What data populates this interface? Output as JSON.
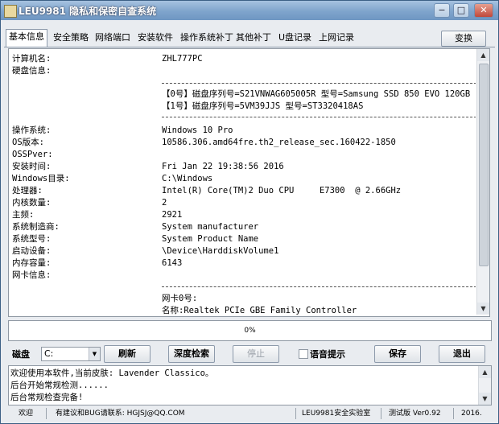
{
  "window": {
    "title": "LEU9981 隐私和保密自查系统",
    "minimize": "−",
    "maximize": "□",
    "close": "✕"
  },
  "tabs": [
    {
      "label": "基本信息",
      "active": true
    },
    {
      "label": "安全策略"
    },
    {
      "label": "网络端口"
    },
    {
      "label": "安装软件"
    },
    {
      "label": "操作系统补丁"
    },
    {
      "label": "其他补丁"
    },
    {
      "label": "U盘记录"
    },
    {
      "label": "上网记录"
    }
  ],
  "change_button": "变换",
  "info": {
    "computer_name": {
      "label": "计算机名:",
      "value": "ZHL777PC"
    },
    "disk_info_label": "硬盘信息:",
    "disks": [
      "【0号】磁盘序列号=S21VNWAG605005R 型号=Samsung SSD 850 EVO 120GB",
      "【1号】磁盘序列号=5VM39JJS 型号=ST3320418AS"
    ],
    "fields": [
      {
        "label": "操作系统:",
        "value": "Windows 10 Pro"
      },
      {
        "label": "OS版本:",
        "value": "10586.306.amd64fre.th2_release_sec.160422-1850"
      },
      {
        "label": "OSSPver:",
        "value": ""
      },
      {
        "label": "安装时间:",
        "value": "Fri Jan 22 19:38:56 2016"
      },
      {
        "label": "Windows目录:",
        "value": "C:\\Windows"
      },
      {
        "label": "处理器:",
        "value": "Intel(R) Core(TM)2 Duo CPU     E7300  @ 2.66GHz"
      },
      {
        "label": "内核数量:",
        "value": "2"
      },
      {
        "label": "主频:",
        "value": "2921"
      },
      {
        "label": "系统制造商:",
        "value": "System manufacturer"
      },
      {
        "label": "系统型号:",
        "value": "System Product Name"
      },
      {
        "label": "启动设备:",
        "value": "\\Device\\HarddiskVolume1"
      },
      {
        "label": "内存容量:",
        "value": "6143"
      }
    ],
    "nic_label": "网卡信息:",
    "nic_first": "网卡0号:",
    "nic_partial": "名称:Realtek PCIe GBE Family Controller"
  },
  "progress": {
    "value": 0,
    "text": "0%"
  },
  "controls": {
    "disk_label": "磁盘",
    "disk_value": "C:",
    "refresh": "刷新",
    "deep_scan": "深度检索",
    "stop": "停止",
    "voice_prompt": "语音提示",
    "save": "保存",
    "exit": "退出"
  },
  "log": [
    "欢迎使用本软件,当前皮肤: Lavender Classico。",
    "后台开始常规检测......",
    "后台常规检查完备!"
  ],
  "status": {
    "welcome": "欢迎",
    "feedback": "有建议和BUG请联系: HGJSJ@QQ.COM",
    "lab": "LEU9981安全实验室",
    "version": "测试版 Ver0.92",
    "year": "2016."
  },
  "colors": {
    "titlebar": "#7fa4cc",
    "progress": "#3aa84a",
    "panel_bg": "#ffffff"
  }
}
